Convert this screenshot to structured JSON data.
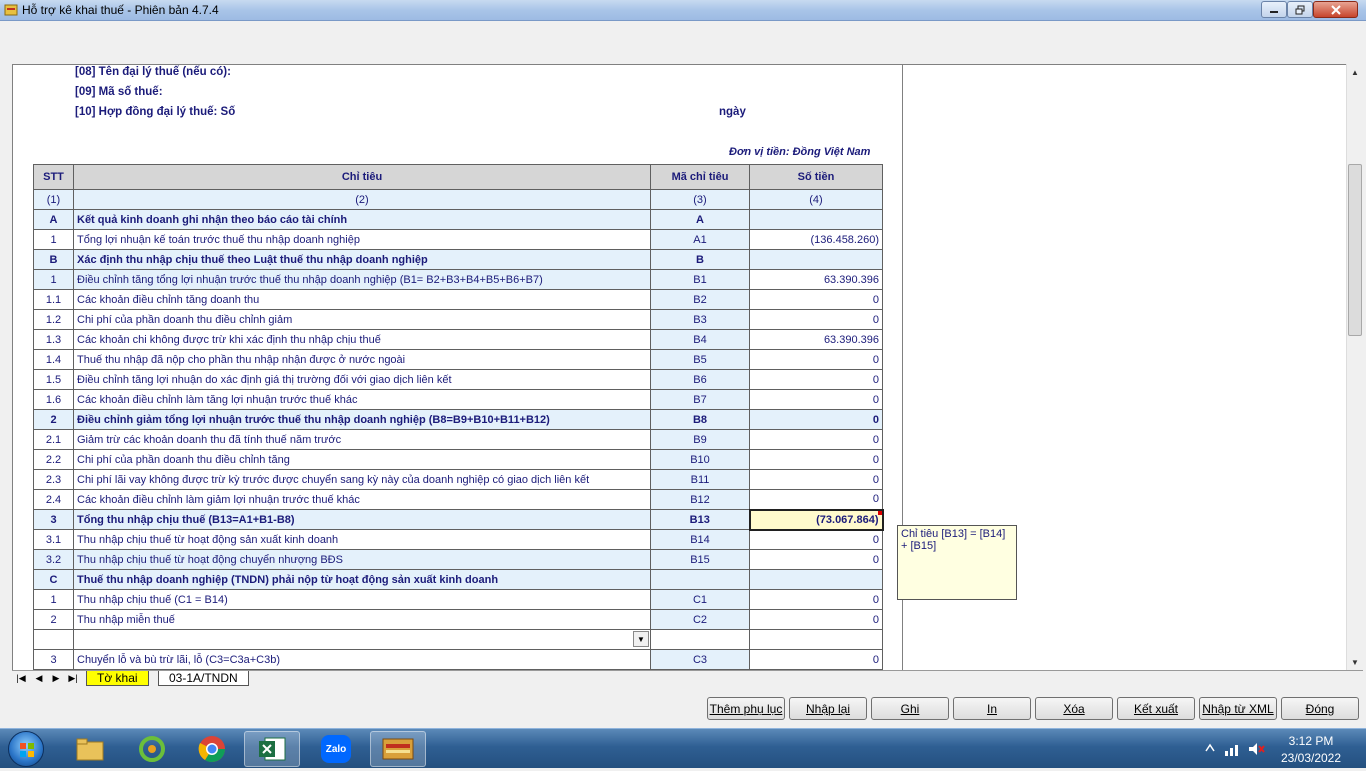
{
  "window": {
    "title": "Hỗ trợ kê khai thuế -  Phiên bản 4.7.4"
  },
  "agent": {
    "line1": "[08] Tên đại lý thuế (nếu có):",
    "line2": "[09] Mã số thuế:",
    "line3": "[10] Hợp đồng đại lý thuế: Số",
    "ngay": "ngày",
    "currency": "Đơn vị tiền: Đồng Việt Nam"
  },
  "table": {
    "headers": [
      "STT",
      "Chỉ tiêu",
      "Mã chỉ tiêu",
      "Số tiền"
    ],
    "subheaders": [
      "(1)",
      "(2)",
      "(3)",
      "(4)"
    ],
    "rows": [
      {
        "stt": "A",
        "label": "Kết quả kinh doanh ghi nhận theo báo cáo tài chính",
        "code": "A",
        "value": "",
        "style": "sect"
      },
      {
        "stt": "1",
        "label": "Tổng lợi nhuận kế toán trước thuế thu nhập doanh nghiệp",
        "code": "A1",
        "value": "(136.458.260)",
        "style": "normal"
      },
      {
        "stt": "B",
        "label": "Xác định thu nhập chịu thuế theo Luật thuế thu nhập doanh nghiệp",
        "code": "B",
        "value": "",
        "style": "sect"
      },
      {
        "stt": "1",
        "label": "Điều chỉnh tăng tổng lợi nhuận trước thuế thu nhập doanh nghiệp (B1= B2+B3+B4+B5+B6+B7)",
        "code": "B1",
        "value": "63.390.396",
        "style": "light"
      },
      {
        "stt": "1.1",
        "label": "Các khoản điều chỉnh tăng doanh thu",
        "code": "B2",
        "value": "0",
        "style": "normal"
      },
      {
        "stt": "1.2",
        "label": "Chi phí của phần doanh thu điều chỉnh giảm",
        "code": "B3",
        "value": "0",
        "style": "normal"
      },
      {
        "stt": "1.3",
        "label": "Các khoản chi không được trừ khi xác định thu nhập chịu thuế",
        "code": "B4",
        "value": "63.390.396",
        "style": "normal"
      },
      {
        "stt": "1.4",
        "label": "Thuế thu nhập đã nộp cho phần thu nhập nhận được ở nước ngoài",
        "code": "B5",
        "value": "0",
        "style": "normal"
      },
      {
        "stt": "1.5",
        "label": "Điều chỉnh tăng lợi nhuận do xác định giá thị trường đối với giao dịch liên kết",
        "code": "B6",
        "value": "0",
        "style": "normal"
      },
      {
        "stt": "1.6",
        "label": "Các khoản điều chỉnh làm tăng lợi nhuận trước thuế khác",
        "code": "B7",
        "value": "0",
        "style": "normal"
      },
      {
        "stt": "2",
        "label": "Điều chỉnh giảm tổng lợi nhuận trước thuế thu nhập doanh nghiệp (B8=B9+B10+B11+B12)",
        "code": "B8",
        "value": "0",
        "style": "bold"
      },
      {
        "stt": "2.1",
        "label": "Giảm trừ các khoản doanh thu đã tính thuế năm trước",
        "code": "B9",
        "value": "0",
        "style": "normal"
      },
      {
        "stt": "2.2",
        "label": "Chi phí của phần doanh thu điều chỉnh tăng",
        "code": "B10",
        "value": "0",
        "style": "normal"
      },
      {
        "stt": "2.3",
        "label": "Chi phí lãi vay không được trừ kỳ trước được chuyển sang kỳ này của doanh  nghiệp có giao dịch liên kết",
        "code": "B11",
        "value": "0",
        "style": "normal"
      },
      {
        "stt": "2.4",
        "label": "Các khoản điều chỉnh làm giảm lợi nhuận trước thuế khác",
        "code": "B12",
        "value": "0",
        "style": "normal"
      },
      {
        "stt": "3",
        "label": "Tổng thu nhập chịu thuế (B13=A1+B1-B8)",
        "code": "B13",
        "value": "(73.067.864)",
        "style": "bold",
        "selected": true
      },
      {
        "stt": "3.1",
        "label": "Thu nhập chịu thuế từ hoạt động sản xuất kinh doanh",
        "code": "B14",
        "value": "0",
        "style": "normal"
      },
      {
        "stt": "3.2",
        "label": "Thu nhập chịu thuế từ hoạt động chuyển nhượng BĐS",
        "code": "B15",
        "value": "0",
        "style": "light"
      },
      {
        "stt": "C",
        "label": "Thuế thu nhập doanh nghiệp (TNDN) phải nộp từ hoạt động sản xuất kinh doanh",
        "code": "",
        "value": "",
        "style": "sect"
      },
      {
        "stt": "1",
        "label": "Thu nhập chịu thuế (C1 = B14)",
        "code": "C1",
        "value": "0",
        "style": "normal"
      },
      {
        "stt": "2",
        "label": "Thu nhập miễn thuế",
        "code": "C2",
        "value": "0",
        "style": "normal"
      },
      {
        "stt": "",
        "label": "",
        "code": "",
        "value": "",
        "style": "dropdown"
      },
      {
        "stt": "3",
        "label": "Chuyển lỗ và bù trừ lãi, lỗ (C3=C3a+C3b)",
        "code": "C3",
        "value": "0",
        "style": "normal"
      }
    ]
  },
  "note": {
    "text": "Chỉ tiêu [B13] = [B14] + [B15]"
  },
  "sheets": {
    "tab1": "Tờ khai",
    "tab2": "03-1A/TNDN"
  },
  "buttons": {
    "them_phu_luc": "Thêm phụ lục",
    "nhap_lai": "Nhập lại",
    "ghi": "Ghi",
    "in": "In",
    "xoa": "Xóa",
    "ket_xuat": "Kết xuất",
    "nhap_tu_xml": "Nhập từ XML",
    "dong": "Đóng"
  },
  "taskbar": {
    "zalo_label": "Zalo",
    "time": "3:12 PM",
    "date": "23/03/2022"
  },
  "colors": {
    "text": "#1b1b7a",
    "section_bg": "#e4f1fb",
    "header_bg": "#d6d6d6",
    "selected_bg": "#fffacd",
    "active_tab": "#ffff00"
  }
}
